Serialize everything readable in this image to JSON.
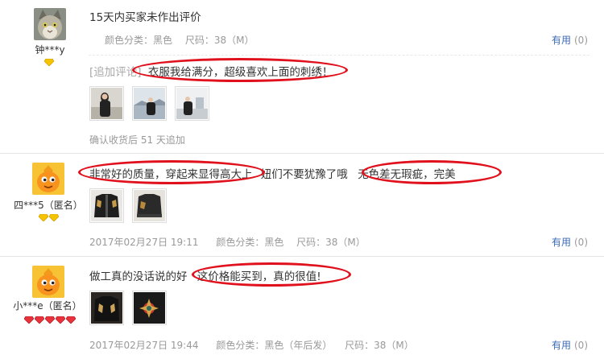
{
  "reviews": [
    {
      "username": "钟***y",
      "text": "15天内买家未作出评价",
      "meta": {
        "color": "颜色分类：黑色",
        "size": "尺码：38（M）"
      },
      "useful_label": "有用",
      "useful_count": "(0)",
      "append": {
        "tag": "[追加评论]",
        "text": "衣服我给满分，超级喜欢上面的刺绣！",
        "note": "确认收货后 51 天追加"
      },
      "avatar": "cat-avatar"
    },
    {
      "username": "四***5（匿名）",
      "text_a": "非常好的质量，穿起来显得高大上",
      "text_b": "妞们不要犹豫了哦",
      "text_c": "无色差无瑕疵，完美",
      "meta": {
        "date": "2017年02月27日 19:11",
        "color": "颜色分类：黑色",
        "size": "尺码：38（M）"
      },
      "useful_label": "有用",
      "useful_count": "(0)",
      "avatar": "orange-mascot-avatar"
    },
    {
      "username": "小***e（匿名）",
      "text_a": "做工真的没话说的好",
      "text_b": "这价格能买到，真的很值!",
      "meta": {
        "date": "2017年02月27日 19:44",
        "color": "颜色分类：黑色（年后发）",
        "size": "尺码：38（M）"
      },
      "useful_label": "有用",
      "useful_count": "(0)",
      "avatar": "orange-mascot-avatar"
    }
  ],
  "colors": {
    "highlight": "#e0101c",
    "link": "#3c6bb5",
    "muted": "#999999"
  }
}
